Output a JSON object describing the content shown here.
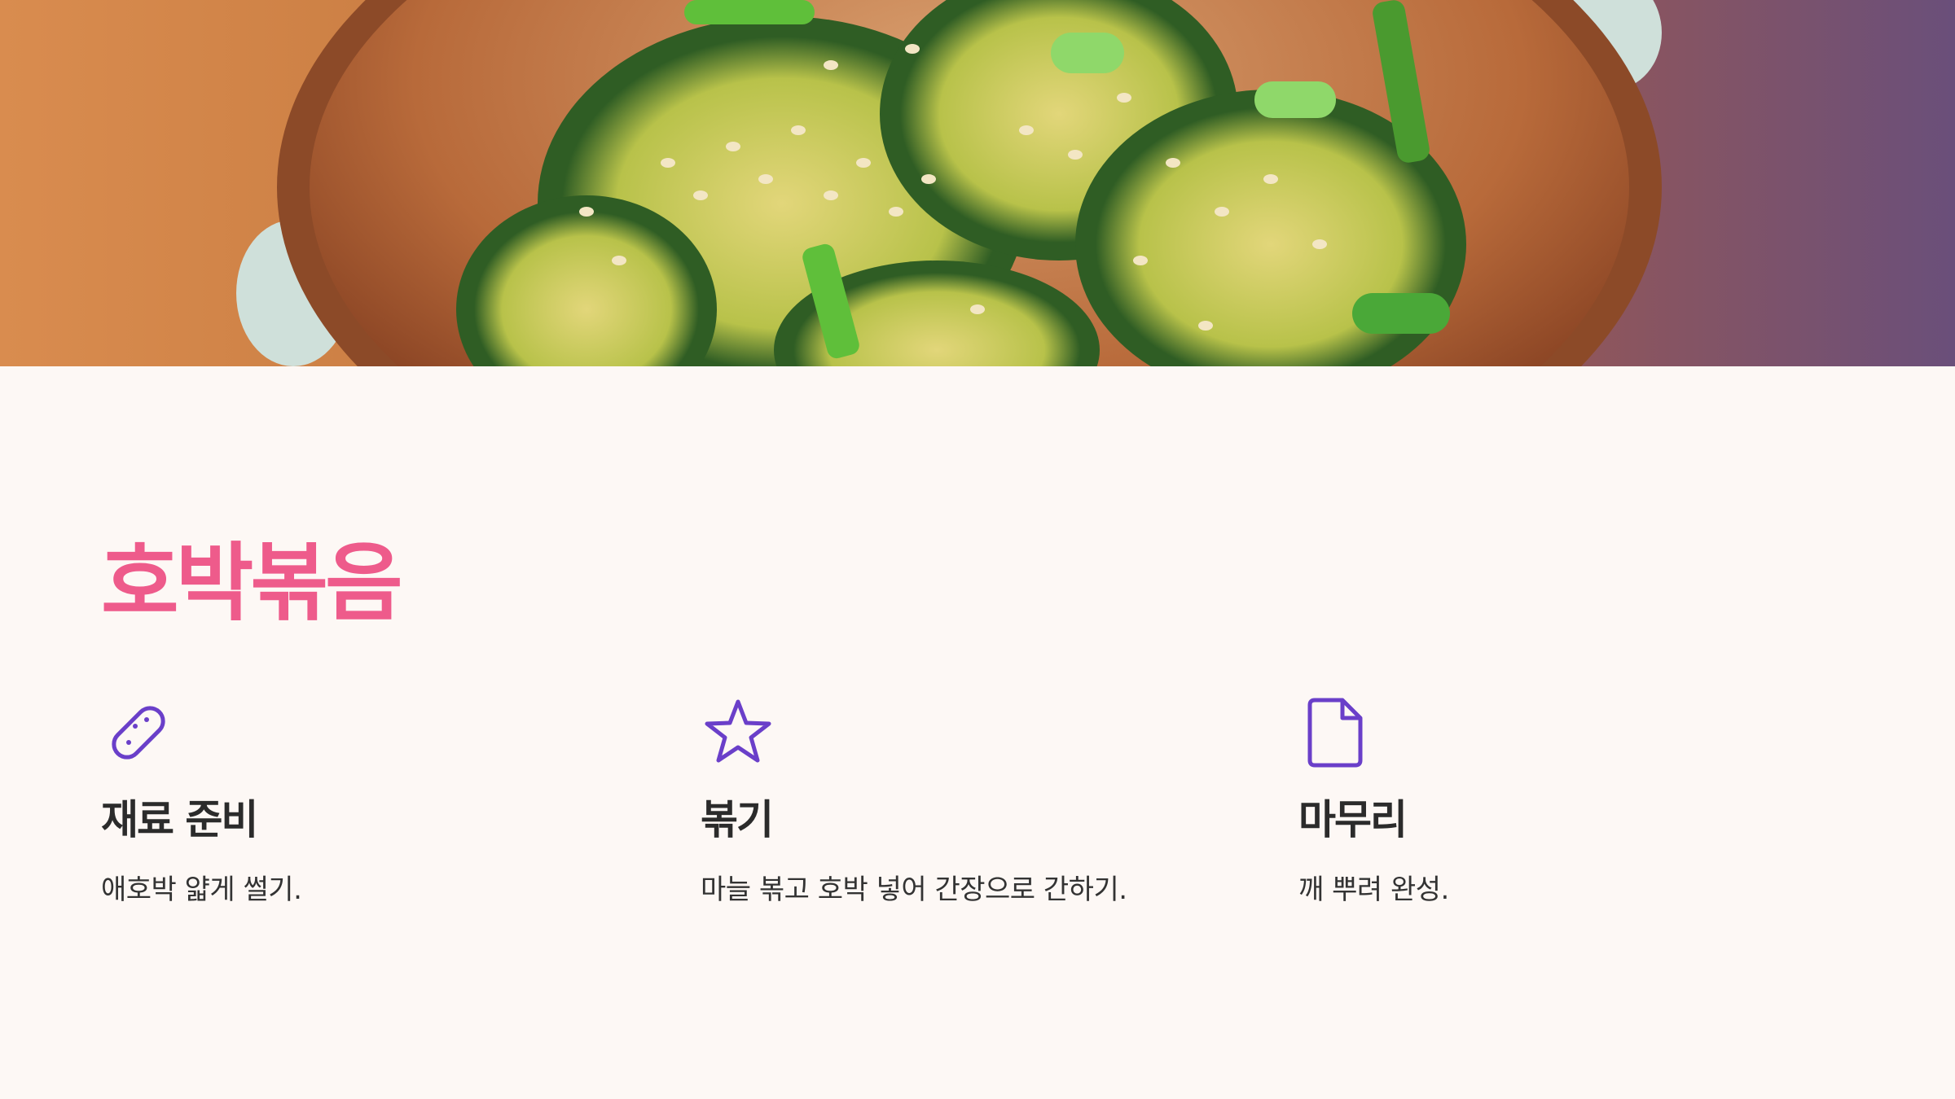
{
  "title": "호박볶음",
  "colors": {
    "title": "#ee5b8b",
    "icon": "#6a3fc9",
    "background": "#fdf8f5",
    "heading": "#2b2b2b",
    "body_text": "#333333"
  },
  "hero": {
    "image": "stir-fried-zucchini-bowl-photo"
  },
  "steps": [
    {
      "icon": "zucchini-icon",
      "title": "재료 준비",
      "text": "애호박 얇게 썰기."
    },
    {
      "icon": "star-icon",
      "title": "볶기",
      "text": "마늘 볶고 호박 넣어 간장으로 간하기."
    },
    {
      "icon": "document-icon",
      "title": "마무리",
      "text": "깨 뿌려 완성."
    }
  ]
}
